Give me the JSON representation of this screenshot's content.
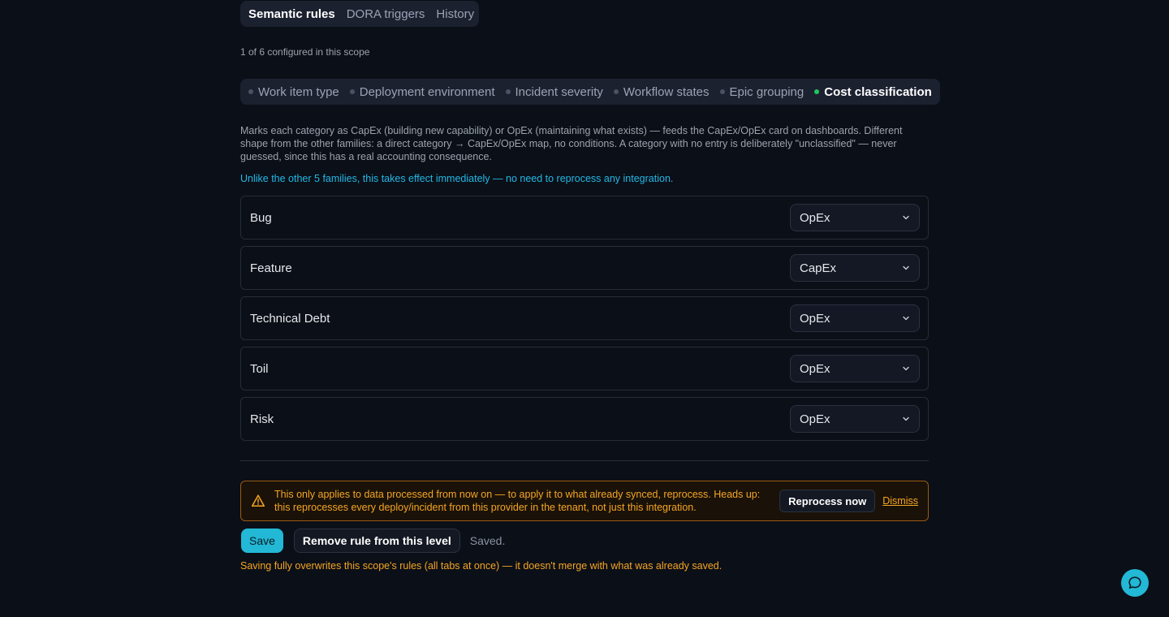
{
  "top_tabs": [
    "Semantic rules",
    "DORA triggers",
    "History"
  ],
  "scope_count": "1 of 6 configured in this scope",
  "family_tabs": [
    "Work item type",
    "Deployment environment",
    "Incident severity",
    "Workflow states",
    "Epic grouping",
    "Cost classification"
  ],
  "description": "Marks each category as CapEx (building new capability) or OpEx (maintaining what exists) — feeds the CapEx/OpEx card on dashboards. Different shape from the other families: a direct category → CapEx/OpEx map, no conditions. A category with no entry is deliberately \"unclassified\" — never guessed, since this has a real accounting consequence.",
  "note": "Unlike the other 5 families, this takes effect immediately — no need to reprocess any integration.",
  "rows": [
    {
      "label": "Bug",
      "value": "OpEx"
    },
    {
      "label": "Feature",
      "value": "CapEx"
    },
    {
      "label": "Technical Debt",
      "value": "OpEx"
    },
    {
      "label": "Toil",
      "value": "OpEx"
    },
    {
      "label": "Risk",
      "value": "OpEx"
    }
  ],
  "warning": {
    "text": "This only applies to data processed from now on — to apply it to what already synced, reprocess. Heads up: this reprocesses every deploy/incident from this provider in the tenant, not just this integration.",
    "reprocess_label": "Reprocess now",
    "dismiss_label": "Dismiss"
  },
  "actions": {
    "save_label": "Save",
    "remove_label": "Remove rule from this level",
    "status": "Saved."
  },
  "overwrite_note": "Saving fully overwrites this scope's rules (all tabs at once) — it doesn't merge with what was already saved.",
  "colors": {
    "accent": "#22b8d6",
    "warning": "#f5a524",
    "active_dot": "#22c55e"
  }
}
